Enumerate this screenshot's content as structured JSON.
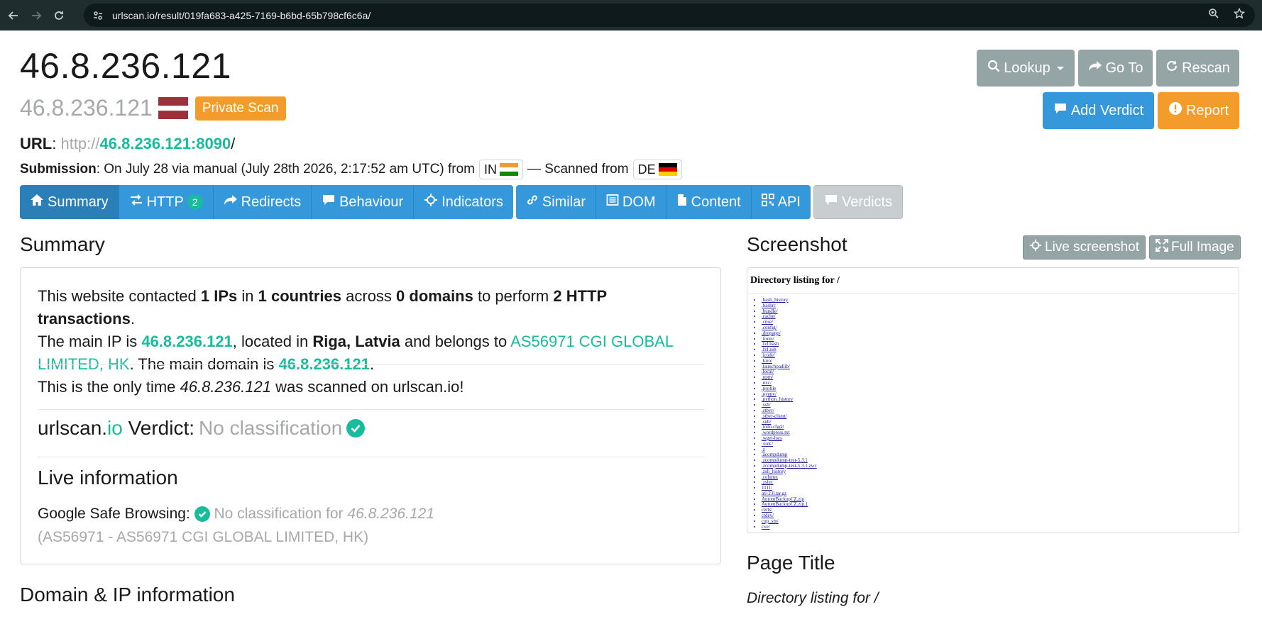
{
  "browser": {
    "url": "urlscan.io/result/019fa683-a425-7169-b6bd-65b798cf6c6a/"
  },
  "header": {
    "title": "46.8.236.121",
    "subtitle_ip": "46.8.236.121",
    "private_badge": "Private Scan"
  },
  "actions": {
    "lookup": "Lookup",
    "goto": "Go To",
    "rescan": "Rescan",
    "add_verdict": "Add Verdict",
    "report": "Report"
  },
  "url_line": {
    "label": "URL",
    "sep": ":",
    "scheme": "http://",
    "host": "46.8.236.121:8090",
    "path": "/"
  },
  "submission": {
    "label": "Submission",
    "text": ": On July 28 via manual (July 28th 2026, 2:17:52 am UTC) from",
    "from_cc": "IN",
    "scanned_text": "— Scanned from",
    "scanned_cc": "DE"
  },
  "tabs": {
    "summary": "Summary",
    "http": "HTTP",
    "http_count": "2",
    "redirects": "Redirects",
    "behaviour": "Behaviour",
    "indicators": "Indicators",
    "similar": "Similar",
    "dom": "DOM",
    "content": "Content",
    "api": "API",
    "verdicts": "Verdicts"
  },
  "summary": {
    "heading": "Summary",
    "p1": {
      "t1": "This website contacted ",
      "ips": "1 IPs",
      "t2": " in ",
      "countries": "1 countries",
      "t3": " across ",
      "domains": "0 domains",
      "t4": " to perform ",
      "transactions": "2 HTTP transactions",
      "t5": ".",
      "t6": "The main IP is ",
      "main_ip": "46.8.236.121",
      "t7": ", located in ",
      "location": "Riga, Latvia",
      "t8": " and belongs to ",
      "asn": "AS56971 CGI GLOBAL LIMITED, HK",
      "t9": ". The main domain is ",
      "main_domain": "46.8.236.121",
      "t10": "."
    },
    "p2": {
      "t1": "This is the only time ",
      "ip": "46.8.236.121",
      "t2": " was scanned on urlscan.io!"
    },
    "verdict": {
      "brand1": "urlscan.",
      "brand2": "io",
      "label": " Verdict: ",
      "value": "No classification"
    },
    "live": {
      "heading": "Live information",
      "gsb_label": "Google Safe Browsing:",
      "gsb_value": "No classification for ",
      "gsb_ip": "46.8.236.121",
      "gsb_as": "(AS56971 - AS56971 CGI GLOBAL LIMITED, HK)"
    }
  },
  "domain_ip": {
    "heading": "Domain & IP information"
  },
  "screenshot": {
    "heading": "Screenshot",
    "live_btn": "Live screenshot",
    "full_btn": "Full Image",
    "page_heading": "Directory listing for /",
    "entries": [
      ".bash_history",
      ".bashrc",
      ".bundle/",
      ".cache/",
      ".cnse/",
      ".config/",
      ".dropapp/",
      ".fonts/",
      ".fzf.bash",
      ".fzf.zsh",
      ".jcode/",
      ".kiro/",
      ".launchpadlib/",
      ".local/",
      ".npm/",
      ".nxc/",
      ".profile",
      ".pyenv/",
      ".python_history",
      ".ssh/",
      ".stbvr/",
      ".stbvr-client/",
      ".sub/",
      ".todo.cfg@",
      ".wordpress.txt",
      ".wget-hsts",
      ".xrdc/",
      ".z",
      ".acompdump",
      ".zcompdump-test-5.3.1",
      ".zcompdump-test-5.3.1.zwc",
      ".zsh_history",
      ".column",
      ".zshrc",
      "1111/",
      "ati-2.0.tar.gz",
      "AutomBackupCZ.zip",
      "AutomBackupCZ.zip.1",
      "certs/",
      "ctdev/",
      "cup_sm/",
      "cve/"
    ]
  },
  "page_title": {
    "heading": "Page Title",
    "value": "Directory listing for /"
  },
  "colors": {
    "accent_green": "#18bc9c",
    "blue": "#3498db",
    "gray": "#95a5a6",
    "orange": "#f39c2b"
  }
}
